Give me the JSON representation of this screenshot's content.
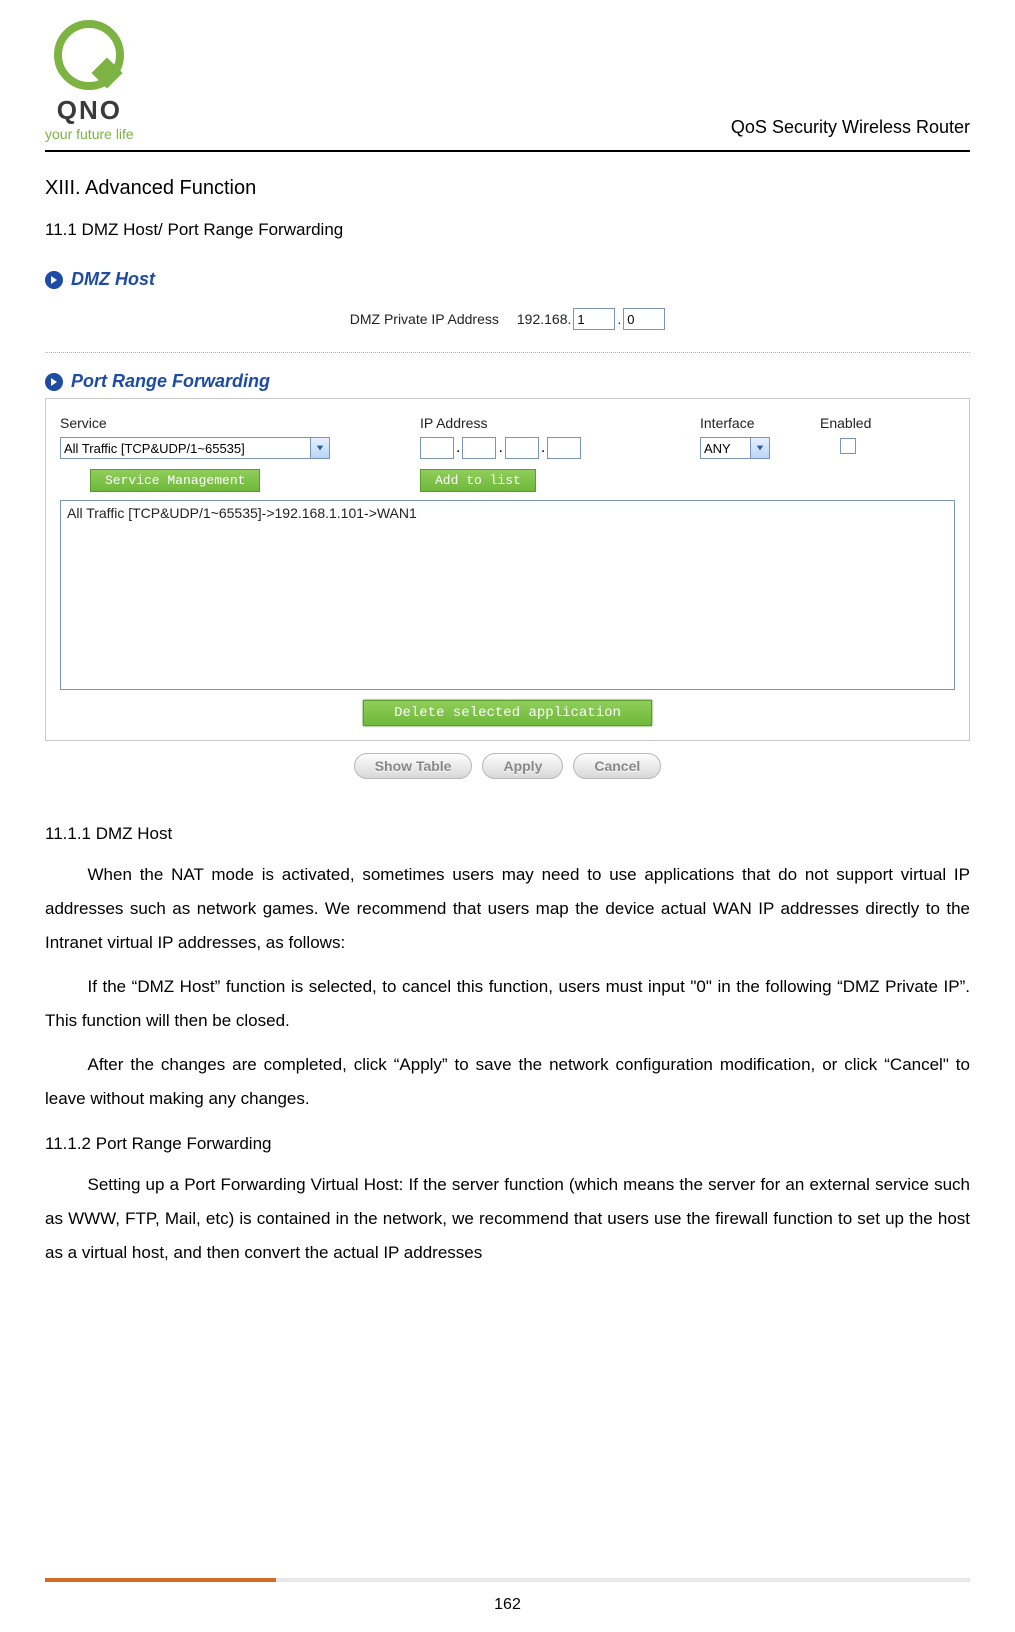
{
  "header": {
    "logo_brand": "QNO",
    "logo_tagline": "your future life",
    "product": "QoS Security Wireless Router"
  },
  "section": {
    "title": "XIII. Advanced Function",
    "subtitle": "11.1 DMZ Host/ Port Range Forwarding"
  },
  "dmz": {
    "panel_title": "DMZ Host",
    "label": "DMZ Private IP Address",
    "prefix": "192.168.",
    "octet3": "1",
    "octet4": "0"
  },
  "prf": {
    "panel_title": "Port Range Forwarding",
    "cols": {
      "service": "Service",
      "ip": "IP Address",
      "interface": "Interface",
      "enabled": "Enabled"
    },
    "service_selected": "All Traffic [TCP&UDP/1~65535]",
    "interface_selected": "ANY",
    "svc_mgmt_btn": "Service Management",
    "add_btn": "Add to list",
    "list_entry": "All Traffic [TCP&UDP/1~65535]->192.168.1.101->WAN1",
    "delete_btn": "Delete selected application",
    "show_table_btn": "Show Table",
    "apply_btn": "Apply",
    "cancel_btn": "Cancel"
  },
  "body": {
    "h_1111": "11.1.1 DMZ Host",
    "p1": "When the NAT mode is activated, sometimes users may need to use applications that do not support virtual IP addresses such as network games. We recommend that users map the device actual WAN IP addresses directly to the Intranet virtual IP addresses, as follows:",
    "p2": "If the “DMZ Host” function is selected, to cancel this function, users must input \"0\" in the following “DMZ Private IP”. This function will then be closed.",
    "p3": "After the changes are completed, click “Apply” to save the network configuration modification, or click “Cancel\" to leave without making any changes.",
    "h_1112": "11.1.2 Port Range Forwarding",
    "p4": "Setting up a Port Forwarding Virtual Host: If the server function (which means the server for an external service such as WWW, FTP, Mail, etc) is contained in the network, we recommend that users use the firewall function to set up the host as a virtual host, and then convert the actual IP addresses"
  },
  "page_number": "162"
}
